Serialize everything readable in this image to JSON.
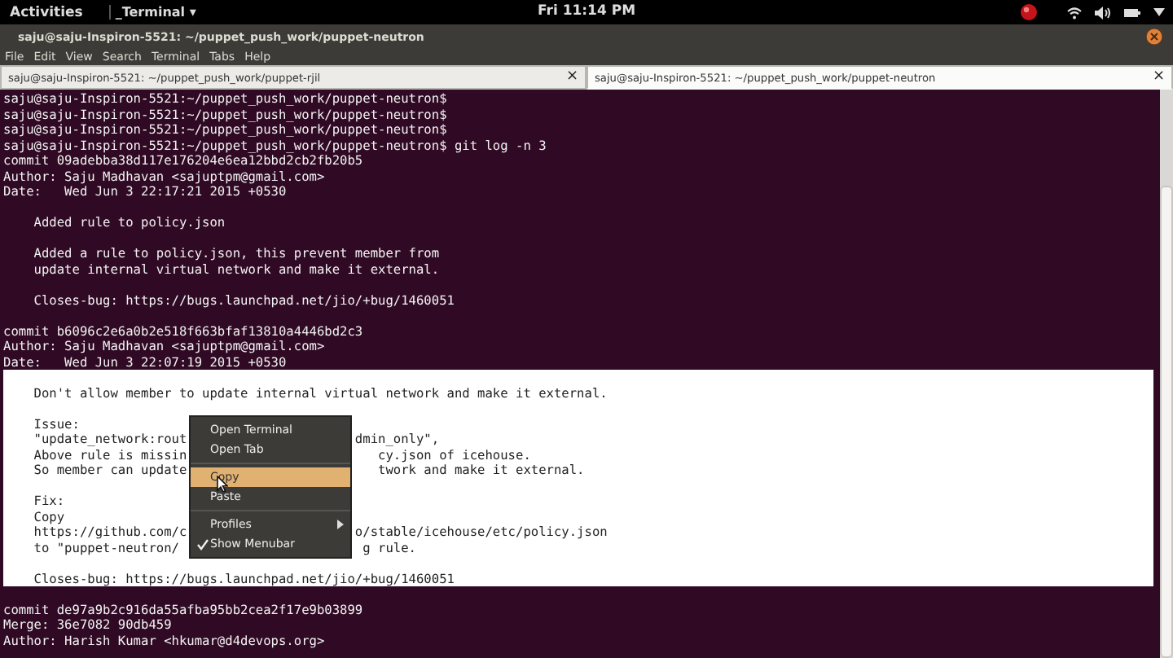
{
  "top_bar": {
    "activities": "Activities",
    "app_menu": "_Terminal ▾",
    "clock": "Fri 11:14 PM"
  },
  "window": {
    "title": "saju@saju-Inspiron-5521: ~/puppet_push_work/puppet-neutron"
  },
  "menu_bar": [
    "File",
    "Edit",
    "View",
    "Search",
    "Terminal",
    "Tabs",
    "Help"
  ],
  "tabs": [
    {
      "label": "saju@saju-Inspiron-5521: ~/puppet_push_work/puppet-rjil",
      "close": "×",
      "selected": false
    },
    {
      "label": "saju@saju-Inspiron-5521: ~/puppet_push_work/puppet-neutron",
      "close": "×",
      "selected": true
    }
  ],
  "terminal": {
    "lines": [
      {
        "kind": "text",
        "text": "saju@saju-Inspiron-5521:~/puppet_push_work/puppet-neutron$",
        "selected": false
      },
      {
        "kind": "text",
        "text": "saju@saju-Inspiron-5521:~/puppet_push_work/puppet-neutron$",
        "selected": false
      },
      {
        "kind": "text",
        "text": "saju@saju-Inspiron-5521:~/puppet_push_work/puppet-neutron$",
        "selected": false
      },
      {
        "kind": "text",
        "text": "saju@saju-Inspiron-5521:~/puppet_push_work/puppet-neutron$ git log -n 3",
        "selected": false
      },
      {
        "kind": "text",
        "text": "commit 09adebba38d117e176204e6ea12bbd2cb2fb20b5",
        "selected": false
      },
      {
        "kind": "text",
        "text": "Author: Saju Madhavan <sajuptpm@gmail.com>",
        "selected": false
      },
      {
        "kind": "text",
        "text": "Date:   Wed Jun 3 22:17:21 2015 +0530",
        "selected": false
      },
      {
        "kind": "blank",
        "selected": false
      },
      {
        "kind": "text",
        "text": "    Added rule to policy.json",
        "selected": false
      },
      {
        "kind": "blank",
        "selected": false
      },
      {
        "kind": "text",
        "text": "    Added a rule to policy.json, this prevent member from",
        "selected": false
      },
      {
        "kind": "text",
        "text": "    update internal virtual network and make it external.",
        "selected": false
      },
      {
        "kind": "blank",
        "selected": false
      },
      {
        "kind": "text",
        "text": "    Closes-bug: https://bugs.launchpad.net/jio/+bug/1460051",
        "selected": false
      },
      {
        "kind": "blank",
        "selected": false
      },
      {
        "kind": "text",
        "text": "commit b6096c2e6a0b2e518f663bfaf13810a4446bd2c3",
        "selected": false
      },
      {
        "kind": "text",
        "text": "Author: Saju Madhavan <sajuptpm@gmail.com>",
        "selected": false
      },
      {
        "kind": "text",
        "text": "Date:   Wed Jun 3 22:07:19 2015 +0530",
        "selected": false
      },
      {
        "kind": "blank",
        "selected": true
      },
      {
        "kind": "text",
        "text": "    Don't allow member to update internal virtual network and make it external.",
        "selected": true
      },
      {
        "kind": "blank",
        "selected": true
      },
      {
        "kind": "text",
        "text": "    Issue:",
        "selected": true
      },
      {
        "kind": "text",
        "text": "    \"update_network:rout                      dmin_only\",",
        "selected": true
      },
      {
        "kind": "text",
        "text": "    Above rule is missin                         cy.json of icehouse.",
        "selected": true
      },
      {
        "kind": "text",
        "text": "    So member can update                         twork and make it external.",
        "selected": true
      },
      {
        "kind": "blank",
        "selected": true
      },
      {
        "kind": "text",
        "text": "    Fix:",
        "selected": true
      },
      {
        "kind": "text",
        "text": "    Copy",
        "selected": true
      },
      {
        "kind": "text",
        "text": "    https://github.com/c                      o/stable/icehouse/etc/policy.json",
        "selected": true
      },
      {
        "kind": "text",
        "text": "    to \"puppet-neutron/                        g rule.",
        "selected": true
      },
      {
        "kind": "blank",
        "selected": true
      },
      {
        "kind": "text",
        "text": "    Closes-bug: https://bugs.launchpad.net/jio/+bug/1460051",
        "selected": true
      },
      {
        "kind": "blank",
        "selected": false
      },
      {
        "kind": "text",
        "text": "commit de97a9b2c916da55afba95bb2cea2f17e9b03899",
        "selected": false
      },
      {
        "kind": "text",
        "text": "Merge: 36e7082 90db459",
        "selected": false
      },
      {
        "kind": "text",
        "text": "Author: Harish Kumar <hkumar@d4devops.org>",
        "selected": false
      }
    ]
  },
  "context_menu": {
    "items": [
      {
        "kind": "item",
        "label": "Open Terminal",
        "selected": false,
        "checked": false,
        "submenu": false
      },
      {
        "kind": "item",
        "label": "Open Tab",
        "selected": false,
        "checked": false,
        "submenu": false
      },
      {
        "kind": "separator"
      },
      {
        "kind": "item",
        "label": "Copy",
        "selected": true,
        "checked": false,
        "submenu": false
      },
      {
        "kind": "item",
        "label": "Paste",
        "selected": false,
        "checked": false,
        "submenu": false
      },
      {
        "kind": "separator"
      },
      {
        "kind": "item",
        "label": "Profiles",
        "selected": false,
        "checked": false,
        "submenu": true
      },
      {
        "kind": "item",
        "label": "Show Menubar",
        "selected": false,
        "checked": true,
        "submenu": false
      }
    ]
  }
}
